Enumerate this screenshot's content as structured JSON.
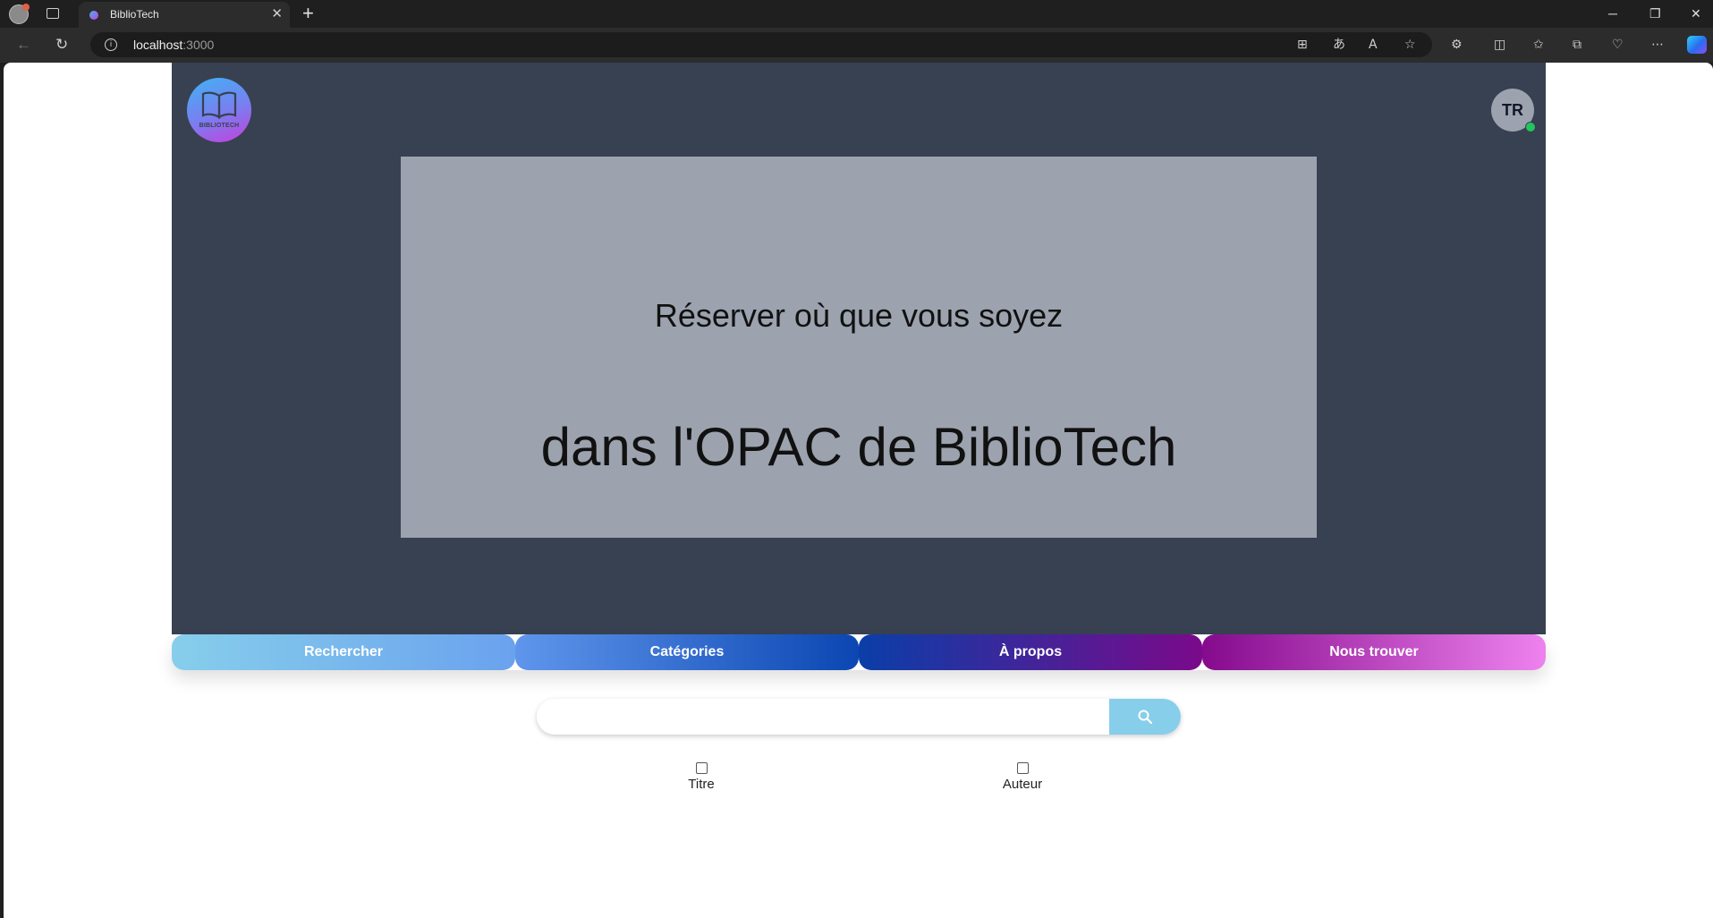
{
  "browser": {
    "tab_title": "BiblioTech",
    "tab_close": "✕",
    "new_tab": "+",
    "url_host": "localhost",
    "url_port": ":3000",
    "window_controls": [
      "─",
      "❐",
      "✕"
    ]
  },
  "header": {
    "logo_text": "BIBLIOTECH",
    "avatar_initials": "TR",
    "status_color": "#22c55e"
  },
  "banner": {
    "line1": "Réserver où que vous soyez",
    "line2": "dans l'OPAC de BiblioTech"
  },
  "nav": {
    "items": [
      {
        "label": "Rechercher"
      },
      {
        "label": "Catégories"
      },
      {
        "label": "À propos"
      },
      {
        "label": "Nous trouver"
      }
    ]
  },
  "search": {
    "value": "",
    "placeholder": "",
    "button_icon": "search-icon",
    "filters": [
      {
        "label": "Titre",
        "checked": false
      },
      {
        "label": "Auteur",
        "checked": false
      }
    ]
  },
  "colors": {
    "hero_bg": "#374151",
    "banner_bg": "#9ca3af",
    "search_button": "#87ceeb"
  }
}
